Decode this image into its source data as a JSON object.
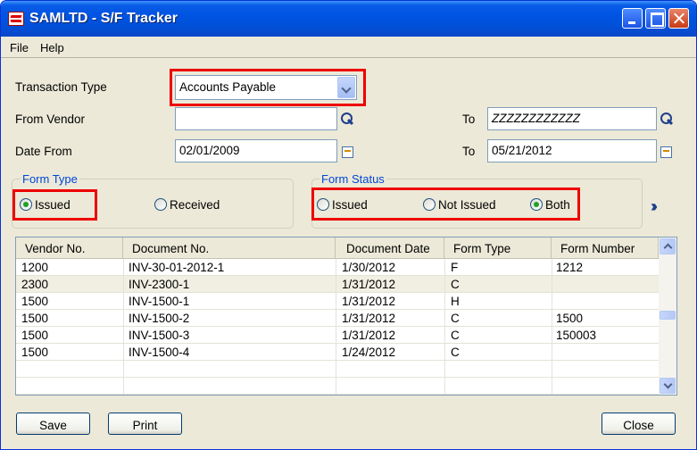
{
  "window": {
    "title": "SAMLTD - S/F Tracker"
  },
  "menu": {
    "file": "File",
    "help": "Help"
  },
  "form": {
    "transaction_type_label": "Transaction Type",
    "transaction_type_value": "Accounts Payable",
    "from_vendor_label": "From Vendor",
    "from_vendor_value": "",
    "to_vendor_label": "To",
    "to_vendor_value": "ZZZZZZZZZZZZ",
    "date_from_label": "Date From",
    "date_from_value": "02/01/2009",
    "date_to_label": "To",
    "date_to_value": "05/21/2012"
  },
  "form_type": {
    "title": "Form Type",
    "issued": "Issued",
    "received": "Received",
    "selected": "Issued"
  },
  "form_status": {
    "title": "Form Status",
    "issued": "Issued",
    "not_issued": "Not Issued",
    "both": "Both",
    "selected": "Both"
  },
  "grid": {
    "columns": [
      "Vendor No.",
      "Document No.",
      "Document Date",
      "Form Type",
      "Form Number"
    ],
    "rows": [
      [
        "1200",
        "INV-30-01-2012-1",
        "1/30/2012",
        "F",
        "1212"
      ],
      [
        "2300",
        "INV-2300-1",
        "1/31/2012",
        "C",
        ""
      ],
      [
        "1500",
        "INV-1500-1",
        "1/31/2012",
        "H",
        ""
      ],
      [
        "1500",
        "INV-1500-2",
        "1/31/2012",
        "C",
        "1500"
      ],
      [
        "1500",
        "INV-1500-3",
        "1/31/2012",
        "C",
        "150003"
      ],
      [
        "1500",
        "INV-1500-4",
        "1/24/2012",
        "C",
        ""
      ]
    ]
  },
  "buttons": {
    "save": "Save",
    "print": "Print",
    "close": "Close"
  },
  "icons": {
    "app": "samltd-logo-icon",
    "lookup": "magnifier-icon",
    "calendar": "calendar-icon",
    "expand": "double-chevron-right-icon"
  },
  "colors": {
    "highlight_box": "#e00000",
    "titlebar": "#0054e3",
    "group_title": "#0046d5"
  }
}
